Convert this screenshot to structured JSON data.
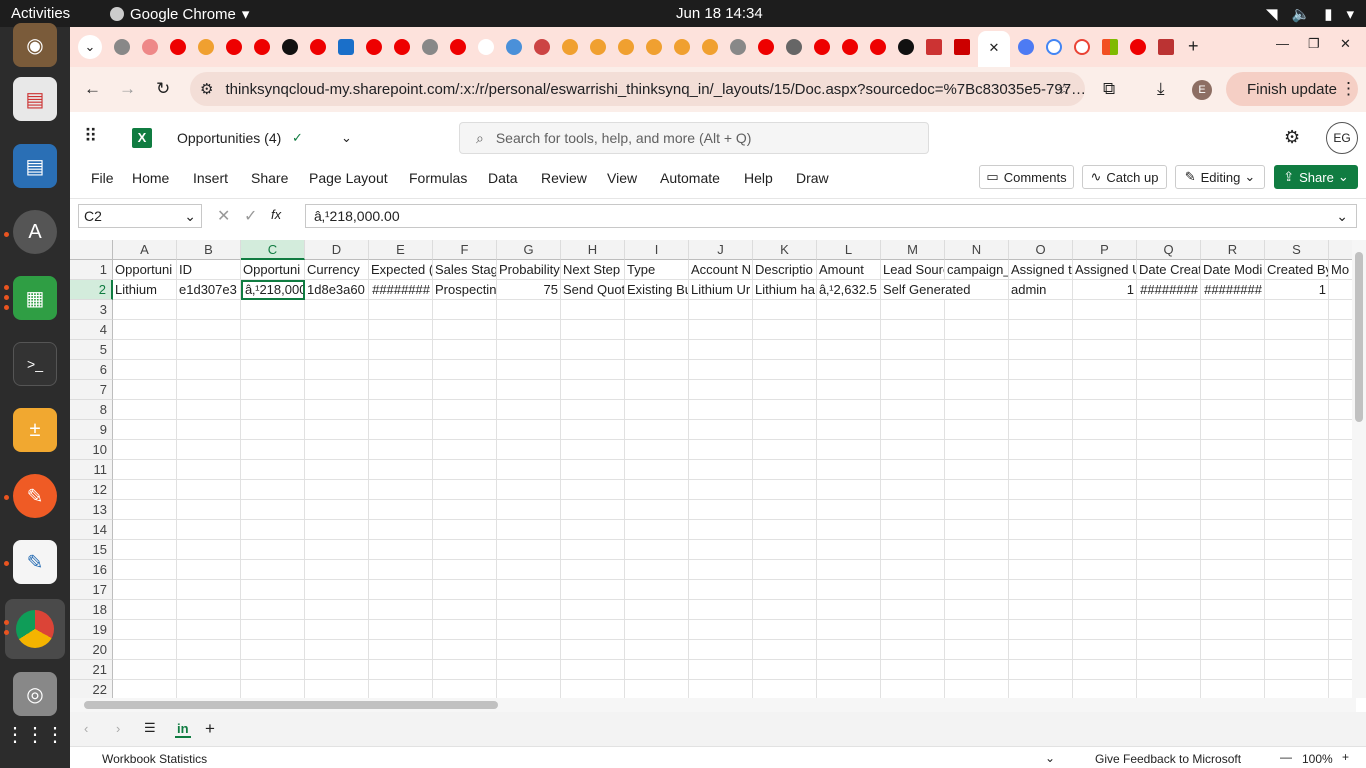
{
  "topbar": {
    "activities": "Activities",
    "app": "Google Chrome",
    "clock": "Jun 18  14:34"
  },
  "browser": {
    "url": "thinksynqcloud-my.sharepoint.com/:x:/r/personal/eswarrishi_thinksynq_in/_layouts/15/Doc.aspx?sourcedoc=%7Bc83035e5-797…",
    "finish_update": "Finish update",
    "profile": "E"
  },
  "excel": {
    "title": "Opportunities (4)",
    "search_placeholder": "Search for tools, help, and more (Alt + Q)",
    "user": "EG",
    "menu": [
      "File",
      "Home",
      "Insert",
      "Share",
      "Page Layout",
      "Formulas",
      "Data",
      "Review",
      "View",
      "Automate",
      "Help",
      "Draw"
    ],
    "comments": "Comments",
    "catchup": "Catch up",
    "editing": "Editing",
    "share": "Share",
    "namebox": "C2",
    "fx": "fx",
    "formula": "â‚¹218,000.00",
    "columns": [
      "A",
      "B",
      "C",
      "D",
      "E",
      "F",
      "G",
      "H",
      "I",
      "J",
      "K",
      "L",
      "M",
      "N",
      "O",
      "P",
      "Q",
      "R",
      "S",
      ""
    ],
    "rows": [
      "1",
      "2",
      "3",
      "4",
      "5",
      "6",
      "7",
      "8",
      "9",
      "10",
      "11",
      "12",
      "13",
      "14",
      "15",
      "16",
      "17",
      "18",
      "19",
      "20",
      "21",
      "22"
    ],
    "row1": [
      "Opportuni",
      "ID",
      "Opportuni",
      "Currency",
      "Expected (",
      "Sales Stag",
      "Probability",
      "Next Step",
      "Type",
      "Account N",
      "Descriptio",
      "Amount",
      "Lead Sourc",
      "campaign_",
      "Assigned t",
      "Assigned U",
      "Date Creat",
      "Date Modi",
      "Created By",
      "Mo"
    ],
    "row2": [
      "Lithium",
      "e1d307e3",
      "â‚¹218,000",
      "1d8e3a60",
      "########",
      "Prospectin",
      "75",
      "Send Quot",
      "Existing Bu",
      "Lithium Ur",
      "Lithium ha",
      "â‚¹2,632.5",
      "Self Generated",
      "",
      "admin",
      "1",
      "########",
      "########",
      "1",
      ""
    ],
    "sheet_tab": "in",
    "status_left": "Workbook Statistics",
    "feedback": "Give Feedback to Microsoft",
    "zoom": "100%"
  }
}
